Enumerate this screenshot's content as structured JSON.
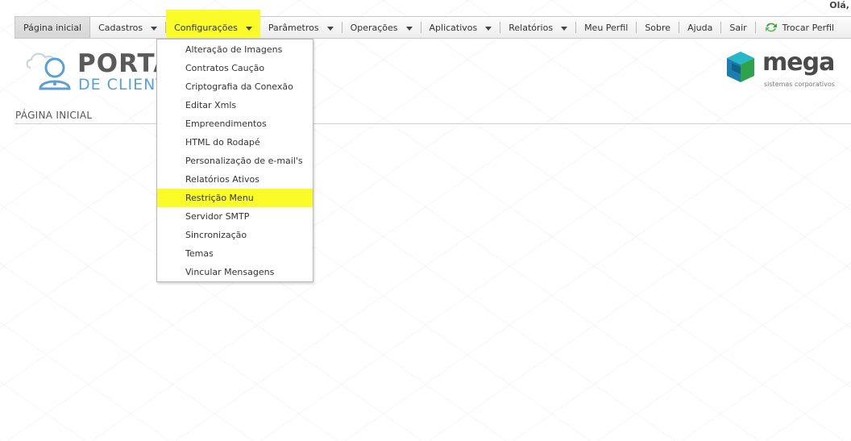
{
  "header": {
    "greeting": "Olá,"
  },
  "menu": {
    "items": [
      {
        "label": "Página inicial"
      },
      {
        "label": "Cadastros"
      },
      {
        "label": "Configurações"
      },
      {
        "label": "Parâmetros"
      },
      {
        "label": "Operações"
      },
      {
        "label": "Aplicativos"
      },
      {
        "label": "Relatórios"
      },
      {
        "label": "Meu Perfil"
      },
      {
        "label": "Sobre"
      },
      {
        "label": "Ajuda"
      },
      {
        "label": "Sair"
      },
      {
        "label": "Trocar Perfil",
        "icon": "swap-profile-icon"
      }
    ]
  },
  "branding": {
    "portal_title": "PORTA",
    "portal_subtitle": "DE CLIENT",
    "mega_name": "mega",
    "mega_tagline": "sistemas corporativos"
  },
  "page": {
    "heading": "PÁGINA INICIAL"
  },
  "dropdown": {
    "items": [
      {
        "label": "Alteração de Imagens"
      },
      {
        "label": "Contratos Caução"
      },
      {
        "label": "Criptografia da Conexão"
      },
      {
        "label": "Editar Xmls"
      },
      {
        "label": "Empreendimentos"
      },
      {
        "label": "HTML do Rodapé"
      },
      {
        "label": "Personalização de e-mail's"
      },
      {
        "label": "Relatórios Ativos"
      },
      {
        "label": "Restrição Menu"
      },
      {
        "label": "Servidor SMTP"
      },
      {
        "label": "Sincronização"
      },
      {
        "label": "Temas"
      },
      {
        "label": "Vincular Mensagens"
      }
    ]
  },
  "colors": {
    "highlight": "#fbfb2a",
    "portal_blue": "#5aa0d8",
    "mega_teal": "#1aa6b7",
    "swap_green": "#3aa63a"
  }
}
